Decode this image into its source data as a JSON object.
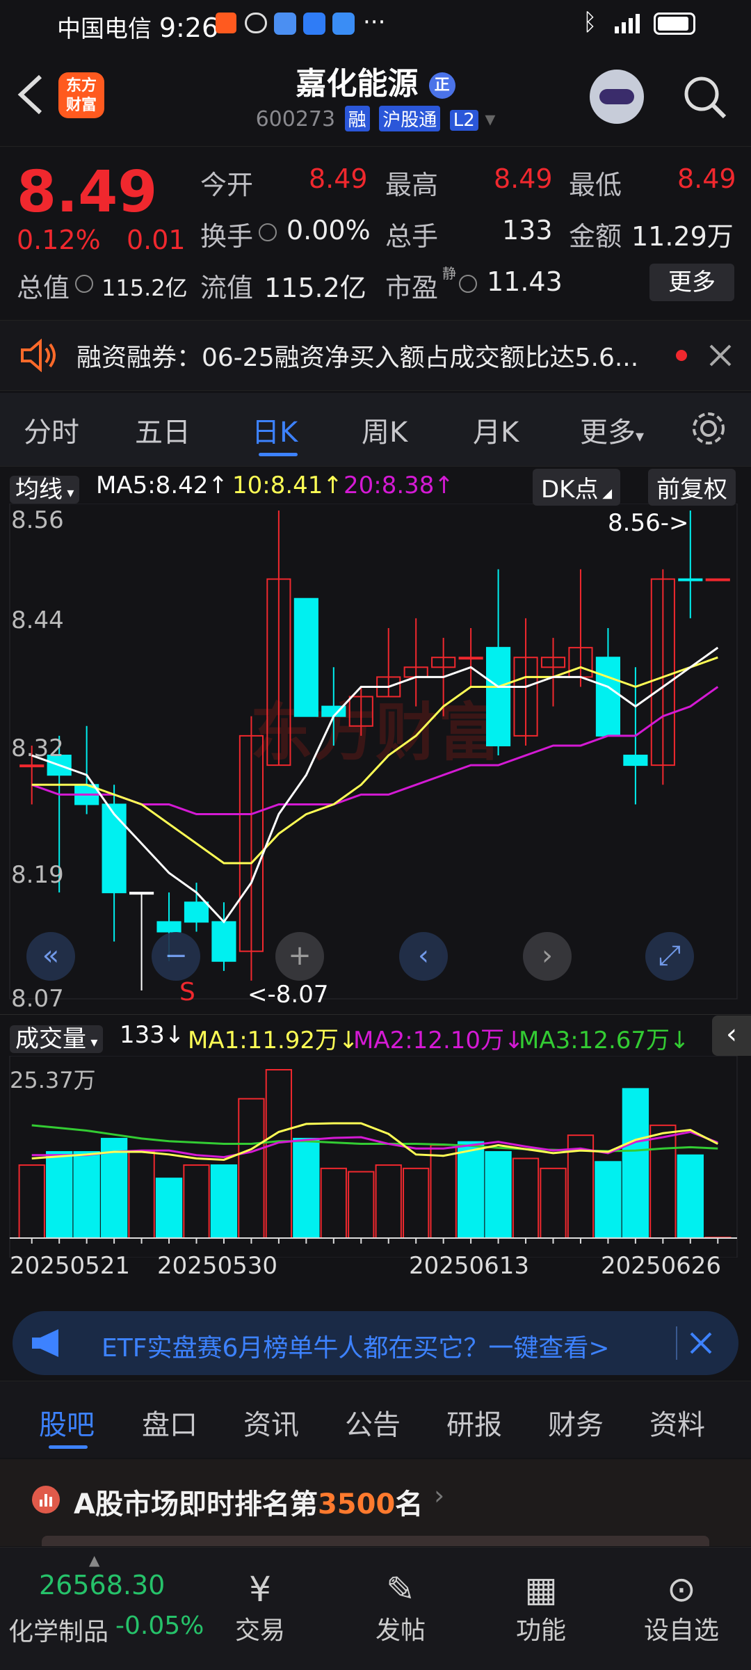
{
  "status": {
    "carrier": "中国电信",
    "time": "9:26",
    "more": "···"
  },
  "header": {
    "logo_line1": "东方",
    "logo_line2": "财富",
    "stock_name": "嘉化能源",
    "badge": "正",
    "code": "600273",
    "tag1": "融",
    "tag2": "沪股通",
    "tag3": "L2"
  },
  "quote": {
    "price": "8.49",
    "pct": "0.12%",
    "change": "0.01",
    "items": [
      {
        "label": "今开",
        "value": "8.49"
      },
      {
        "label": "最高",
        "value": "8.49"
      },
      {
        "label": "最低",
        "value": "8.49"
      },
      {
        "label": "换手",
        "value": "0.00%"
      },
      {
        "label": "总手",
        "value": "133"
      },
      {
        "label": "金额",
        "value": "11.29万"
      },
      {
        "label": "总值",
        "value": "115.2亿"
      },
      {
        "label": "流值",
        "value": "115.2亿"
      },
      {
        "label": "市盈",
        "value": "11.43"
      }
    ],
    "pe_super": "静",
    "more_btn": "更多"
  },
  "notice": {
    "text": "融资融券：06-25融资净买入额占成交额比达5.6..."
  },
  "tabs": [
    {
      "label": "分时"
    },
    {
      "label": "五日"
    },
    {
      "label": "日K"
    },
    {
      "label": "周K"
    },
    {
      "label": "月K"
    },
    {
      "label": "更多"
    }
  ],
  "chart": {
    "ma_select": "均线",
    "ma5": "MA5:8.42",
    "ma10": "10:8.41",
    "ma20": "20:8.38",
    "dk_btn": "DK点",
    "fq_btn": "前复权",
    "y_labels": [
      "8.56",
      "8.44",
      "8.32",
      "8.19",
      "8.07"
    ],
    "high_marker": "8.56->",
    "low_marker": "<-8.07",
    "sell_mark": "S",
    "vol_select": "成交量",
    "vol_now": "133",
    "vol_ma1": "MA1:11.92万",
    "vol_ma2": "MA2:12.10万",
    "vol_ma3": "MA3:12.67万",
    "vol_max": "25.37万",
    "dates": [
      "20250521",
      "20250530",
      "20250613",
      "20250626"
    ]
  },
  "chart_data": {
    "type": "candlestick",
    "y_range": [
      8.07,
      8.56
    ],
    "candles": [
      {
        "o": 8.3,
        "c": 8.3,
        "h": 8.32,
        "l": 8.26,
        "color": "red"
      },
      {
        "o": 8.31,
        "c": 8.29,
        "h": 8.33,
        "l": 8.17,
        "color": "cyan"
      },
      {
        "o": 8.28,
        "c": 8.26,
        "h": 8.34,
        "l": 8.25,
        "color": "cyan"
      },
      {
        "o": 8.26,
        "c": 8.17,
        "h": 8.28,
        "l": 8.12,
        "color": "cyan"
      },
      {
        "o": 8.17,
        "c": 8.17,
        "h": 8.17,
        "l": 8.07,
        "color": "white"
      },
      {
        "o": 8.14,
        "c": 8.13,
        "h": 8.17,
        "l": 8.1,
        "color": "cyan"
      },
      {
        "o": 8.16,
        "c": 8.14,
        "h": 8.18,
        "l": 8.13,
        "color": "cyan"
      },
      {
        "o": 8.14,
        "c": 8.1,
        "h": 8.16,
        "l": 8.09,
        "color": "cyan"
      },
      {
        "o": 8.11,
        "c": 8.33,
        "h": 8.35,
        "l": 8.08,
        "color": "red"
      },
      {
        "o": 8.3,
        "c": 8.49,
        "h": 8.56,
        "l": 8.3,
        "color": "red"
      },
      {
        "o": 8.47,
        "c": 8.35,
        "h": 8.47,
        "l": 8.35,
        "color": "cyan"
      },
      {
        "o": 8.36,
        "c": 8.35,
        "h": 8.4,
        "l": 8.32,
        "color": "cyan"
      },
      {
        "o": 8.34,
        "c": 8.37,
        "h": 8.38,
        "l": 8.33,
        "color": "red"
      },
      {
        "o": 8.37,
        "c": 8.39,
        "h": 8.44,
        "l": 8.37,
        "color": "red"
      },
      {
        "o": 8.39,
        "c": 8.4,
        "h": 8.45,
        "l": 8.36,
        "color": "red"
      },
      {
        "o": 8.4,
        "c": 8.41,
        "h": 8.43,
        "l": 8.35,
        "color": "red"
      },
      {
        "o": 8.41,
        "c": 8.41,
        "h": 8.44,
        "l": 8.38,
        "color": "red"
      },
      {
        "o": 8.42,
        "c": 8.32,
        "h": 8.5,
        "l": 8.31,
        "color": "cyan"
      },
      {
        "o": 8.33,
        "c": 8.41,
        "h": 8.45,
        "l": 8.32,
        "color": "red"
      },
      {
        "o": 8.4,
        "c": 8.41,
        "h": 8.43,
        "l": 8.36,
        "color": "red"
      },
      {
        "o": 8.39,
        "c": 8.42,
        "h": 8.5,
        "l": 8.38,
        "color": "red"
      },
      {
        "o": 8.41,
        "c": 8.33,
        "h": 8.44,
        "l": 8.33,
        "color": "cyan"
      },
      {
        "o": 8.31,
        "c": 8.3,
        "h": 8.4,
        "l": 8.26,
        "color": "cyan"
      },
      {
        "o": 8.3,
        "c": 8.49,
        "h": 8.5,
        "l": 8.28,
        "color": "red"
      },
      {
        "o": 8.49,
        "c": 8.49,
        "h": 8.56,
        "l": 8.45,
        "color": "cyan"
      },
      {
        "o": 8.49,
        "c": 8.49,
        "h": 8.49,
        "l": 8.49,
        "color": "red"
      }
    ],
    "ma5": [
      8.31,
      8.3,
      8.29,
      8.25,
      8.22,
      8.19,
      8.17,
      8.14,
      8.18,
      8.25,
      8.29,
      8.35,
      8.38,
      8.38,
      8.39,
      8.39,
      8.4,
      8.38,
      8.38,
      8.39,
      8.39,
      8.38,
      8.36,
      8.38,
      8.4,
      8.42
    ],
    "ma10": [
      8.28,
      8.28,
      8.28,
      8.27,
      8.26,
      8.24,
      8.22,
      8.2,
      8.2,
      8.23,
      8.25,
      8.26,
      8.28,
      8.31,
      8.33,
      8.36,
      8.38,
      8.38,
      8.39,
      8.39,
      8.4,
      8.39,
      8.38,
      8.39,
      8.4,
      8.41
    ],
    "ma20": [
      8.28,
      8.27,
      8.27,
      8.27,
      8.26,
      8.26,
      8.25,
      8.25,
      8.25,
      8.26,
      8.26,
      8.26,
      8.27,
      8.27,
      8.28,
      8.29,
      8.3,
      8.3,
      8.31,
      8.32,
      8.32,
      8.33,
      8.33,
      8.35,
      8.36,
      8.38
    ],
    "volumes": [
      {
        "v": 11,
        "color": "red"
      },
      {
        "v": 13,
        "color": "cyan"
      },
      {
        "v": 13,
        "color": "cyan"
      },
      {
        "v": 15,
        "color": "cyan"
      },
      {
        "v": 13,
        "color": "red"
      },
      {
        "v": 9,
        "color": "cyan"
      },
      {
        "v": 11,
        "color": "red"
      },
      {
        "v": 11,
        "color": "cyan"
      },
      {
        "v": 21,
        "color": "red"
      },
      {
        "v": 25.37,
        "color": "red"
      },
      {
        "v": 15,
        "color": "cyan"
      },
      {
        "v": 10.5,
        "color": "red"
      },
      {
        "v": 10,
        "color": "red"
      },
      {
        "v": 11,
        "color": "red"
      },
      {
        "v": 10.5,
        "color": "red"
      },
      {
        "v": 14,
        "color": "red"
      },
      {
        "v": 14.5,
        "color": "cyan"
      },
      {
        "v": 13,
        "color": "cyan"
      },
      {
        "v": 12,
        "color": "red"
      },
      {
        "v": 10.5,
        "color": "red"
      },
      {
        "v": 15.5,
        "color": "red"
      },
      {
        "v": 11.5,
        "color": "cyan"
      },
      {
        "v": 22.5,
        "color": "cyan"
      },
      {
        "v": 17,
        "color": "red"
      },
      {
        "v": 12.5,
        "color": "cyan"
      },
      {
        "v": 0.1,
        "color": "red"
      }
    ],
    "vol_ma_white": [
      12.5,
      12.5,
      12.5,
      13,
      13.2,
      13.2,
      12.5,
      12.2,
      13,
      14.4,
      14.8,
      15.1,
      15.2,
      14.2,
      13.5,
      13.5,
      14,
      14.5,
      13.8,
      13.2,
      13.5,
      12.8,
      14.5,
      15.2,
      16,
      14.4
    ],
    "vol_ma_yellow": [
      12,
      12.3,
      12.6,
      13,
      13,
      12.6,
      12,
      11.8,
      13.4,
      16,
      17.2,
      17.3,
      17.3,
      15.7,
      12.6,
      12.4,
      13.2,
      14,
      13.4,
      12.8,
      13.2,
      13,
      14.8,
      15.8,
      16.3,
      14.2
    ],
    "vol_ma_green": [
      17,
      16.6,
      16.2,
      15.6,
      15,
      14.6,
      14.4,
      14.2,
      14.2,
      14.6,
      14.6,
      14.4,
      14.2,
      14.2,
      14.2,
      14.1,
      13.9,
      13.6,
      13.4,
      13.3,
      13.2,
      13.1,
      13.2,
      13.5,
      13.7,
      13.5
    ]
  },
  "banner": {
    "text": "ETF实盘赛6月榜单牛人都在买它？一键查看>"
  },
  "bottom_tabs": [
    {
      "label": "股吧"
    },
    {
      "label": "盘口"
    },
    {
      "label": "资讯"
    },
    {
      "label": "公告"
    },
    {
      "label": "研报"
    },
    {
      "label": "财务"
    },
    {
      "label": "资料"
    }
  ],
  "rank": {
    "prefix": "A股市场即时排名第",
    "num": "3500",
    "suffix": "名"
  },
  "footer": {
    "index_value": "26568.30",
    "index_name": "化学制品",
    "index_pct": "-0.05%",
    "items": [
      {
        "label": "交易"
      },
      {
        "label": "发帖"
      },
      {
        "label": "功能"
      },
      {
        "label": "设自选"
      }
    ]
  },
  "colors": {
    "up": "#f0282e",
    "down": "#00f0f0",
    "ma5": "#ffffff",
    "ma10": "#ffff55",
    "ma20": "#d41ad4",
    "vma3": "#33cc33",
    "accent": "#3d82ff"
  }
}
